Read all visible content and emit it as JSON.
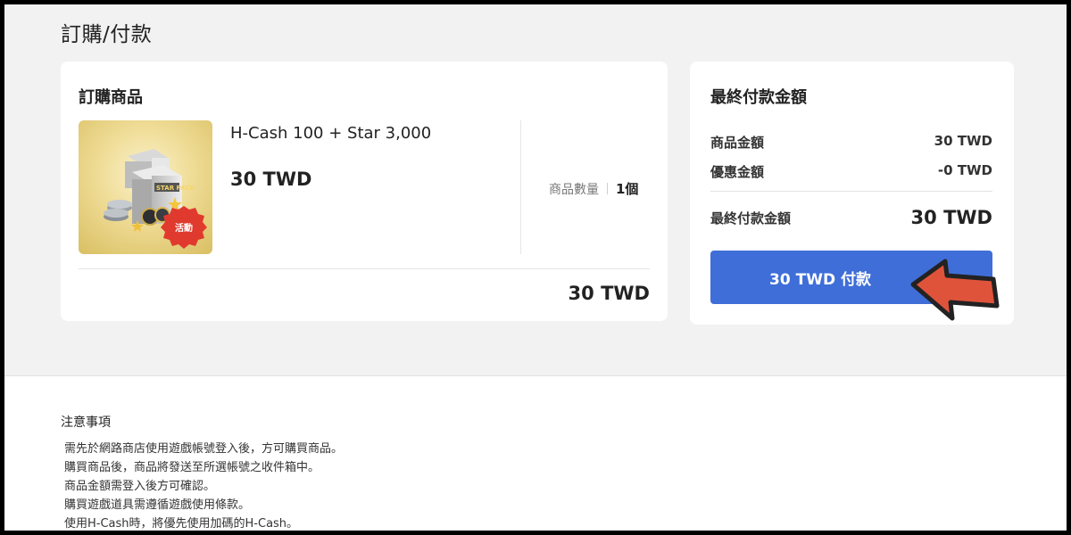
{
  "page": {
    "title": "訂購/付款"
  },
  "order": {
    "heading": "訂購商品",
    "product": {
      "name": "H-Cash 100 + Star 3,000",
      "price": "30 TWD",
      "thumb_box_text": "STAR PACK",
      "badge": "活動",
      "quantity_label": "商品數量",
      "quantity_value": "1個"
    },
    "total": "30 TWD"
  },
  "payment": {
    "heading": "最終付款金額",
    "rows": [
      {
        "label": "商品金額",
        "value": "30 TWD"
      },
      {
        "label": "優惠金額",
        "value": "-0 TWD"
      }
    ],
    "final_label": "最終付款金額",
    "final_value": "30 TWD",
    "button_label": "30 TWD  付款",
    "accent_color": "#3f6ed8",
    "pointer_color": "#e0533b"
  },
  "notice": {
    "title": "注意事項",
    "items": [
      "需先於網路商店使用遊戲帳號登入後，方可購買商品。",
      "購買商品後，商品將發送至所選帳號之收件箱中。",
      "商品金額需登入後方可確認。",
      "購買遊戲道具需遵循遊戲使用條款。",
      "使用H-Cash時，將優先使用加碼的H-Cash。"
    ]
  }
}
